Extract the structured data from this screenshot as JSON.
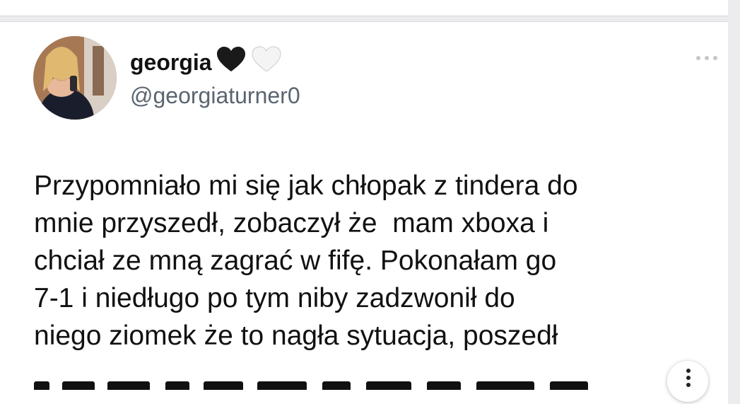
{
  "tweet": {
    "display_name": "georgia",
    "name_emojis": [
      "black-heart-icon",
      "white-heart-icon"
    ],
    "handle": "@georgiaturner0",
    "text_lines": [
      "Przypomniało mi się jak chłopak z tindera do",
      "mnie przyszedł, zobaczył że  mam xboxa i",
      "chciał ze mną zagrać w fifę. Pokonałam go",
      "7-1 i niedługo po tym niby zadzwonił do",
      "niego ziomek że to nagła sytuacja, poszedł"
    ]
  },
  "colors": {
    "background": "#ececee",
    "card": "#ffffff",
    "text": "#111111",
    "handle": "#5b6570",
    "more_dots": "#c7c7cb"
  }
}
